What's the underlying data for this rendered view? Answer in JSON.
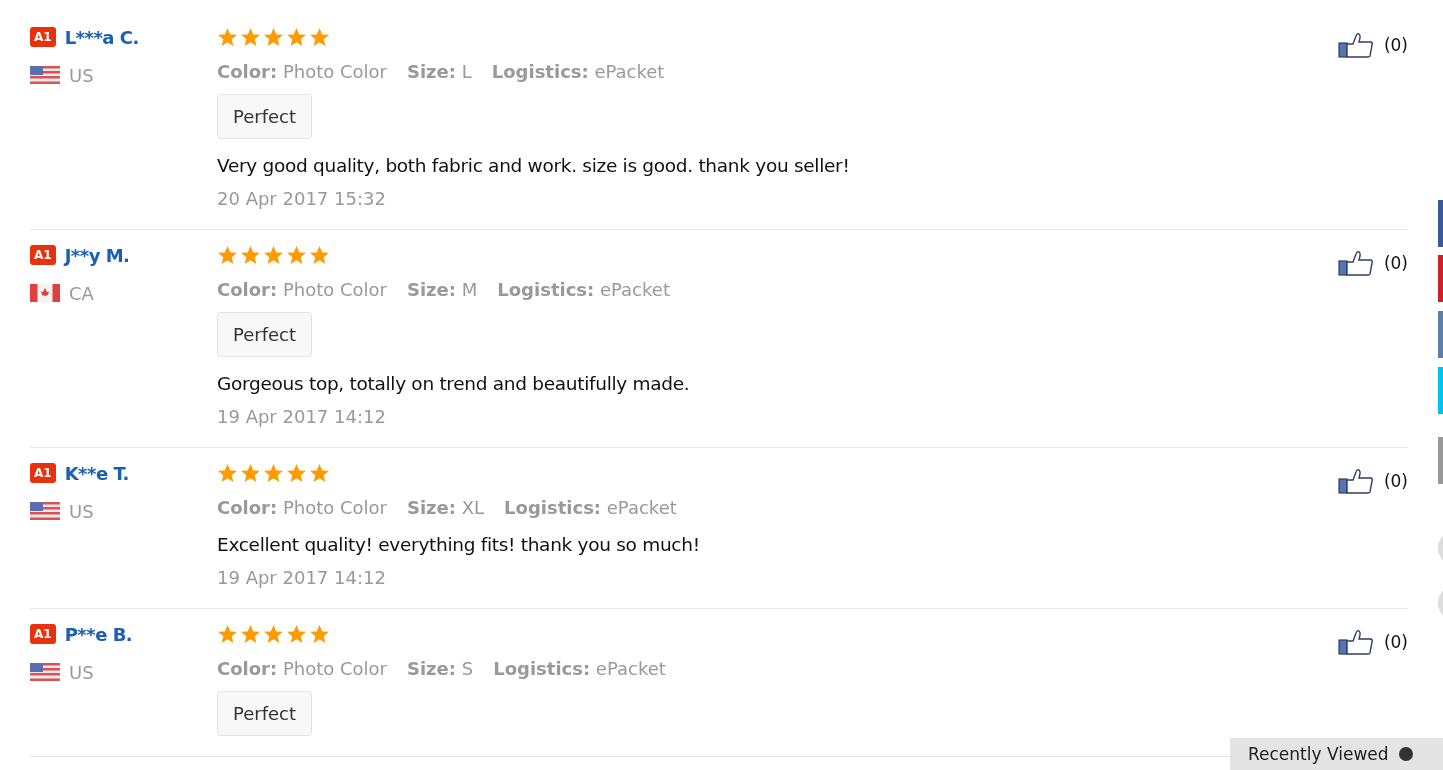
{
  "reviews": [
    {
      "badge": "A1",
      "name": "L***a C.",
      "kind": "us",
      "country": "US",
      "stars": 5,
      "attributes": [
        {
          "label": "Color:",
          "value": "Photo Color"
        },
        {
          "label": "Size:",
          "value": "L"
        },
        {
          "label": "Logistics:",
          "value": "ePacket"
        }
      ],
      "tag": "Perfect",
      "text": "Very good quality, both fabric and work. size is good. thank you seller!",
      "date": "20 Apr 2017 15:32",
      "likes": "(0)"
    },
    {
      "badge": "A1",
      "name": "J**y M.",
      "kind": "ca",
      "country": "CA",
      "stars": 5,
      "attributes": [
        {
          "label": "Color:",
          "value": "Photo Color"
        },
        {
          "label": "Size:",
          "value": "M"
        },
        {
          "label": "Logistics:",
          "value": "ePacket"
        }
      ],
      "tag": "Perfect",
      "text": "Gorgeous top, totally on trend and beautifully made.",
      "date": "19 Apr 2017 14:12",
      "likes": "(0)"
    },
    {
      "badge": "A1",
      "name": "K**e T.",
      "kind": "us",
      "country": "US",
      "stars": 5,
      "attributes": [
        {
          "label": "Color:",
          "value": "Photo Color"
        },
        {
          "label": "Size:",
          "value": "XL"
        },
        {
          "label": "Logistics:",
          "value": "ePacket"
        }
      ],
      "text": "Excellent quality! everything fits! thank you so much!",
      "date": "19 Apr 2017 14:12",
      "likes": "(0)"
    },
    {
      "badge": "A1",
      "name": "P**e B.",
      "kind": "us",
      "country": "US",
      "stars": 5,
      "attributes": [
        {
          "label": "Color:",
          "value": "Photo Color"
        },
        {
          "label": "Size:",
          "value": "S"
        },
        {
          "label": "Logistics:",
          "value": "ePacket"
        }
      ],
      "tag": "Perfect",
      "likes": "(0)"
    }
  ],
  "recently_viewed": {
    "title": "Recently Viewed"
  }
}
